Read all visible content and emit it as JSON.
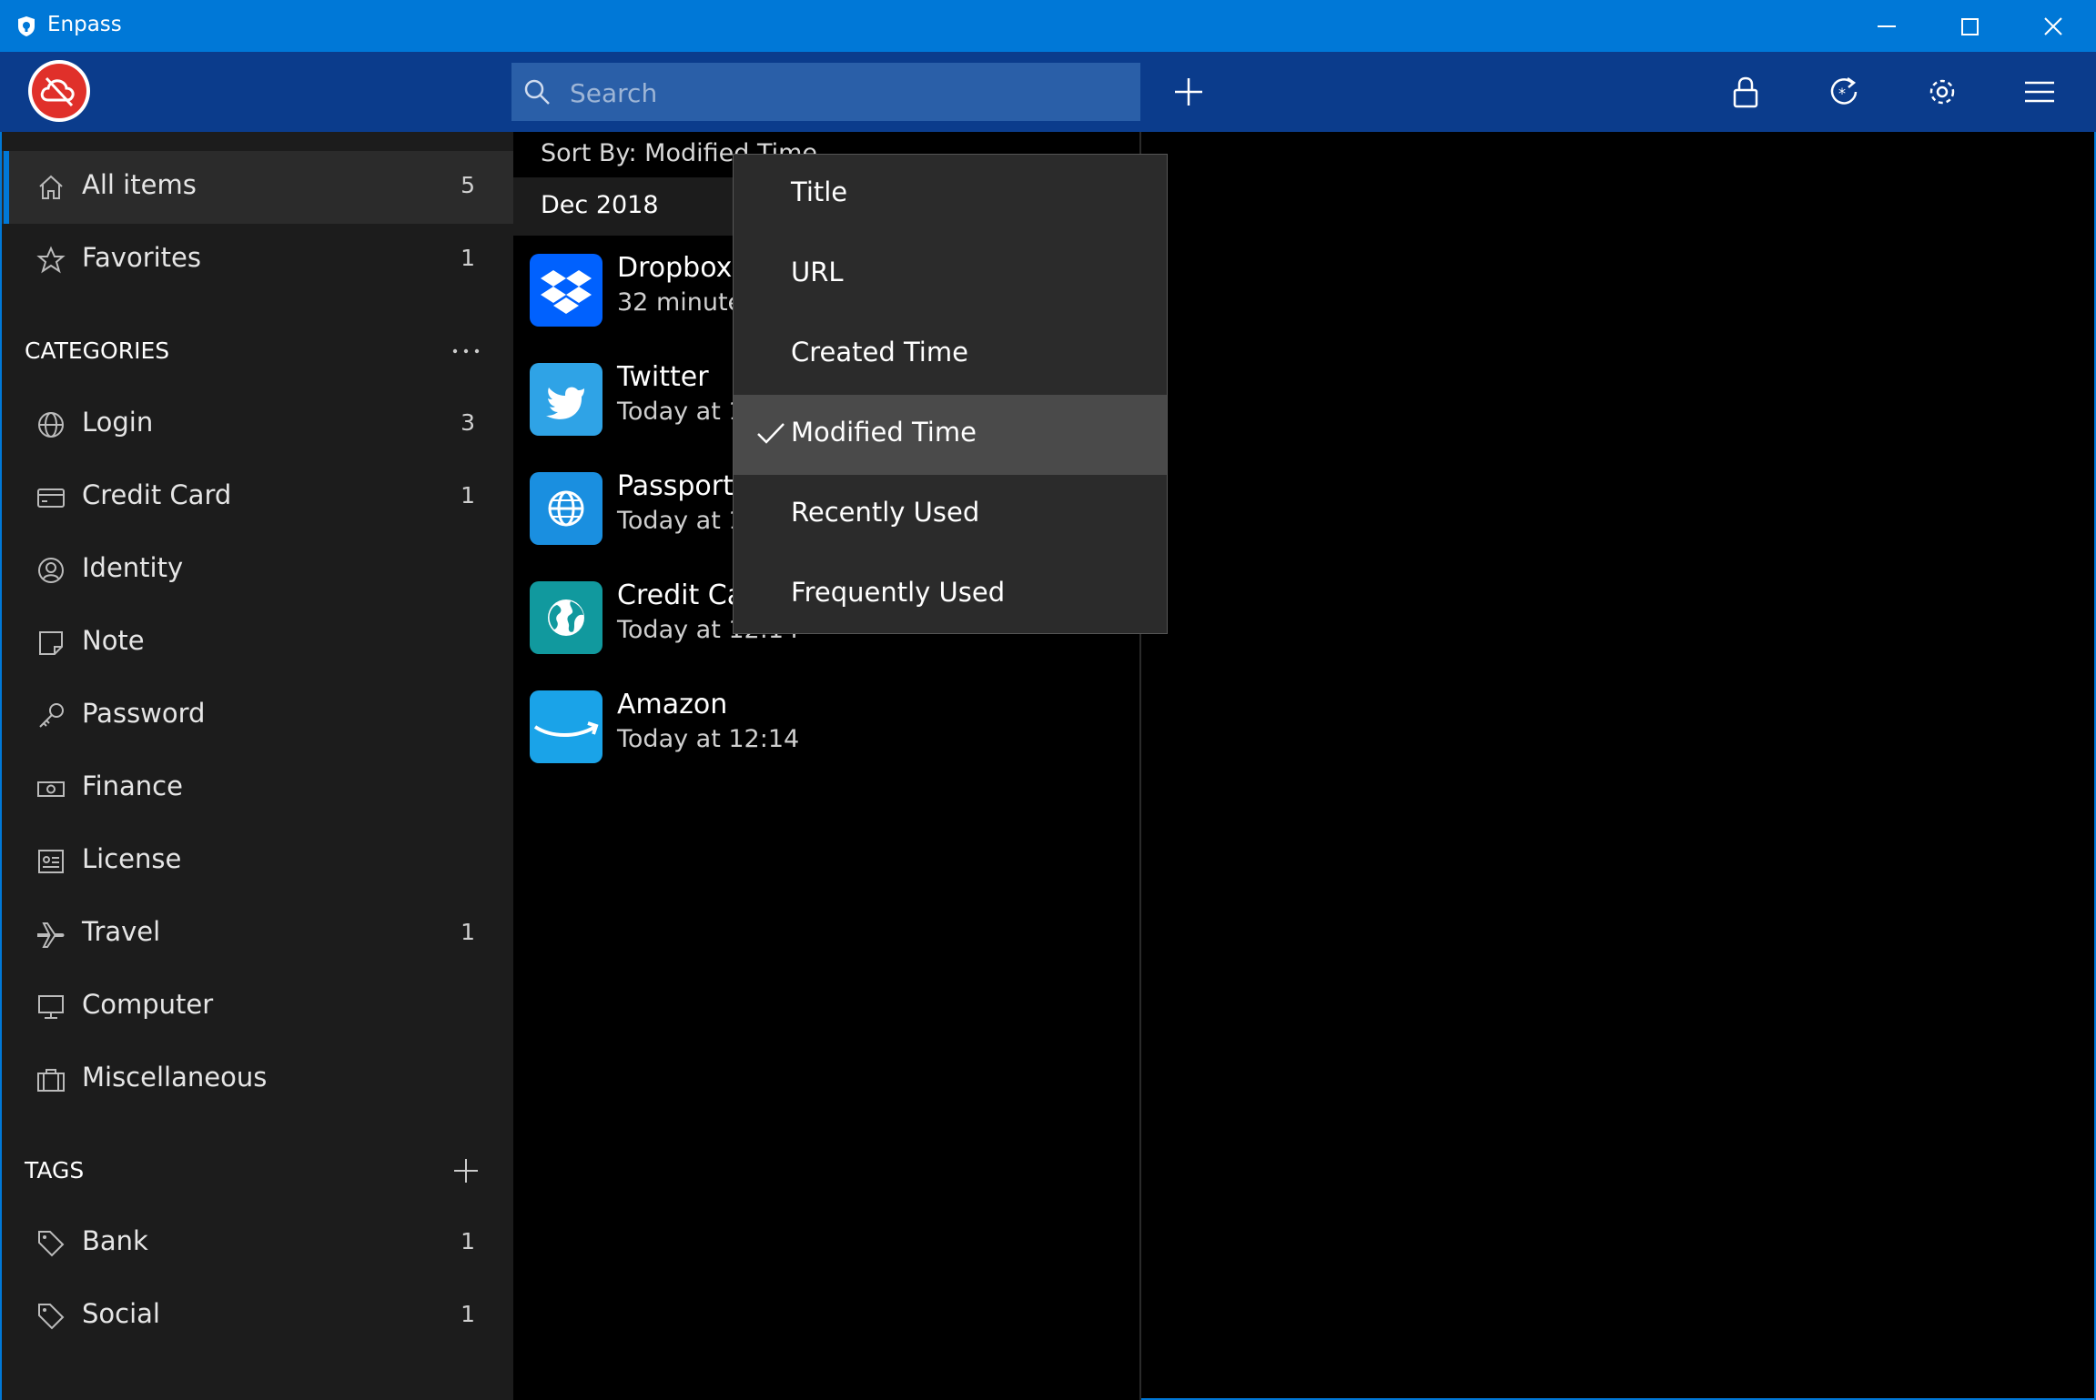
{
  "window": {
    "title": "Enpass",
    "controls": [
      "minimize",
      "maximize",
      "close"
    ]
  },
  "toolbar": {
    "search_placeholder": "Search",
    "buttons": [
      "add-icon",
      "lock-icon",
      "sync-icon",
      "settings-icon",
      "menu-icon"
    ]
  },
  "sidebar": {
    "main": [
      {
        "label": "All items",
        "count": "5",
        "icon": "home-icon",
        "active": true
      },
      {
        "label": "Favorites",
        "count": "1",
        "icon": "star-icon"
      }
    ],
    "categories_header": "CATEGORIES",
    "categories": [
      {
        "label": "Login",
        "count": "3",
        "icon": "globe-icon"
      },
      {
        "label": "Credit Card",
        "count": "1",
        "icon": "credit-card-icon"
      },
      {
        "label": "Identity",
        "count": "",
        "icon": "identity-icon"
      },
      {
        "label": "Note",
        "count": "",
        "icon": "note-icon"
      },
      {
        "label": "Password",
        "count": "",
        "icon": "key-icon"
      },
      {
        "label": "Finance",
        "count": "",
        "icon": "finance-icon"
      },
      {
        "label": "License",
        "count": "",
        "icon": "license-icon"
      },
      {
        "label": "Travel",
        "count": "1",
        "icon": "plane-icon"
      },
      {
        "label": "Computer",
        "count": "",
        "icon": "computer-icon"
      },
      {
        "label": "Miscellaneous",
        "count": "",
        "icon": "briefcase-icon"
      }
    ],
    "tags_header": "TAGS",
    "tags": [
      {
        "label": "Bank",
        "count": "1",
        "icon": "tag-icon"
      },
      {
        "label": "Social",
        "count": "1",
        "icon": "tag-icon"
      }
    ]
  },
  "list": {
    "sort_label": "Sort By: Modified Time",
    "group": "Dec 2018",
    "items": [
      {
        "title": "Dropbox",
        "subtitle": "32 minute",
        "icon": "dropbox-icon",
        "color": "#0061fe"
      },
      {
        "title": "Twitter",
        "subtitle": "Today at 1",
        "icon": "twitter-icon",
        "color": "#2fa3e6"
      },
      {
        "title": "Passport",
        "subtitle": "Today at 1",
        "icon": "globe-icon",
        "color": "#1a8fe0"
      },
      {
        "title": "Credit Ca",
        "subtitle": "Today at 12:14",
        "icon": "earth-icon",
        "color": "#11999e"
      },
      {
        "title": "Amazon",
        "subtitle": "Today at 12:14",
        "icon": "amazon-icon",
        "color": "#1aa3e8"
      }
    ]
  },
  "sort_menu": {
    "options": [
      "Title",
      "URL",
      "Created Time",
      "Modified Time",
      "Recently Used",
      "Frequently Used"
    ],
    "selected": "Modified Time"
  },
  "colors": {
    "titlebar": "#0078d7",
    "toolbar": "#0b3c8c",
    "search": "#2a5fa8",
    "brand": "#e0302a",
    "sidebar": "#1c1c1c",
    "menu": "#2b2b2b"
  }
}
